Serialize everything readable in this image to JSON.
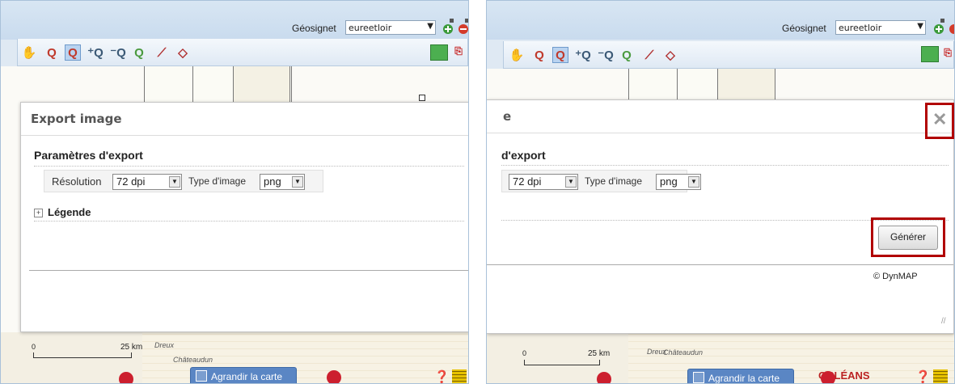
{
  "geosignet": {
    "label": "Géosignet",
    "value": "eureetloir"
  },
  "dialog": {
    "title": "Export image",
    "title_cut": "e",
    "section": "Paramètres d'export",
    "section_cut": "d'export",
    "resolution_label": "Résolution",
    "resolution_value": "72 dpi",
    "type_label": "Type d'image",
    "type_value": "png",
    "legend_label": "Légende",
    "generate_button": "Générer",
    "copyright": "© DynMAP",
    "close_symbol": "✕"
  },
  "map": {
    "scale_zero": "0",
    "scale_value": "25 km",
    "enlarge_label": "Agrandir la carte",
    "place_label": "Châteaudun",
    "place_label2": "Dreux",
    "place_label3": "ORLÉANS"
  },
  "highlight_color": "#b10000",
  "accent_color": "#5a86c4"
}
